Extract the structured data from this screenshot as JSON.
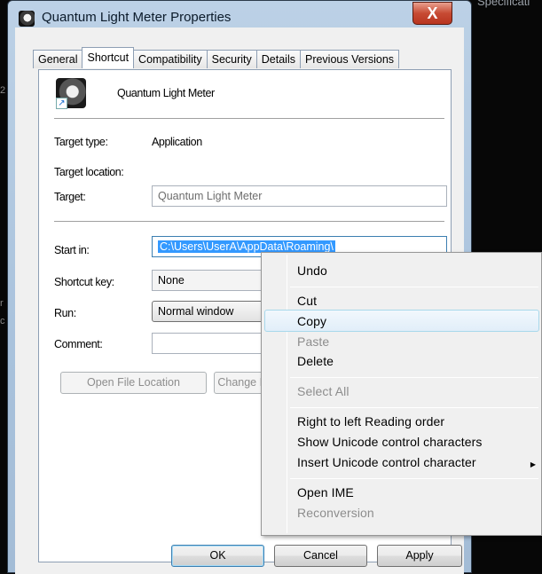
{
  "background": {
    "top_right_text": "Specificati",
    "left_fragments": [
      "2",
      "r",
      "c"
    ]
  },
  "window": {
    "title": "Quantum Light Meter Properties",
    "close_label": "X",
    "tabs": [
      "General",
      "Shortcut",
      "Compatibility",
      "Security",
      "Details",
      "Previous Versions"
    ],
    "active_tab": "Shortcut"
  },
  "shortcut": {
    "name": "Quantum Light Meter",
    "target_type_label": "Target type:",
    "target_type_value": "Application",
    "target_location_label": "Target location:",
    "target_label": "Target:",
    "target_value": "Quantum Light Meter",
    "start_in_label": "Start in:",
    "start_in_value": "C:\\Users\\UserA\\AppData\\Roaming\\",
    "shortcut_key_label": "Shortcut key:",
    "shortcut_key_value": "None",
    "run_label": "Run:",
    "run_value": "Normal window",
    "comment_label": "Comment:",
    "comment_value": "",
    "open_file_location_label": "Open File Location",
    "change_icon_label": "Change Icon..."
  },
  "footer": {
    "ok": "OK",
    "cancel": "Cancel",
    "apply": "Apply"
  },
  "context_menu": {
    "undo": "Undo",
    "cut": "Cut",
    "copy": "Copy",
    "paste": "Paste",
    "delete": "Delete",
    "select_all": "Select All",
    "rtl": "Right to left Reading order",
    "show_unicode": "Show Unicode control characters",
    "insert_unicode": "Insert Unicode control character",
    "submenu_arrow": "▶",
    "open_ime": "Open IME",
    "reconversion": "Reconversion"
  }
}
